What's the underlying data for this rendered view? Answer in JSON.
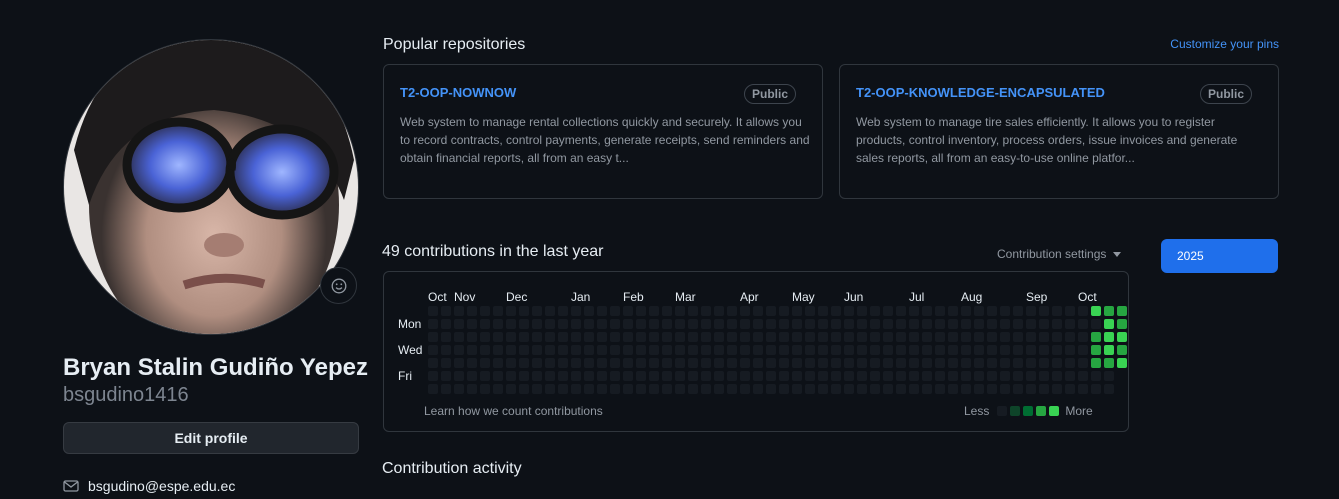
{
  "profile": {
    "full_name": "Bryan Stalin Gudiño Yepez",
    "username": "bsgudino1416",
    "edit_label": "Edit profile",
    "email": "bsgudino@espe.edu.ec",
    "status_icon": "smiley-icon"
  },
  "repos": {
    "title": "Popular repositories",
    "customize_label": "Customize your pins",
    "items": [
      {
        "name": "T2-OOP-NOWNOW",
        "visibility": "Public",
        "description": "Web system to manage rental collections quickly and securely. It allows you to record contracts, control payments, generate receipts, send reminders and obtain financial reports, all from an easy t..."
      },
      {
        "name": "T2-OOP-KNOWLEDGE-ENCAPSULATED",
        "visibility": "Public",
        "description": "Web system to manage tire sales efficiently. It allows you to register products, control inventory, process orders, issue invoices and generate sales reports, all from an easy-to-use online platfor..."
      }
    ]
  },
  "contributions": {
    "title": "49 contributions in the last year",
    "settings_label": "Contribution settings",
    "year_label": "2025",
    "learn_label": "Learn how we count contributions",
    "less_label": "Less",
    "more_label": "More",
    "months": [
      "Oct",
      "Nov",
      "Dec",
      "Jan",
      "Feb",
      "Mar",
      "Apr",
      "May",
      "Jun",
      "Jul",
      "Aug",
      "Sep",
      "Oct"
    ],
    "month_start_weeks": [
      0,
      2,
      6,
      11,
      15,
      19,
      24,
      28,
      32,
      37,
      41,
      46,
      50
    ],
    "day_labels": [
      "",
      "Mon",
      "",
      "Wed",
      "",
      "Fri",
      ""
    ],
    "weeks": 53,
    "level_colors": [
      "#161b22",
      "#0e4429",
      "#006d32",
      "#26a641",
      "#39d353"
    ],
    "active_cells": [
      {
        "week": 51,
        "day": 0,
        "level": 4
      },
      {
        "week": 51,
        "day": 2,
        "level": 3
      },
      {
        "week": 51,
        "day": 3,
        "level": 3
      },
      {
        "week": 51,
        "day": 4,
        "level": 3
      },
      {
        "week": 52,
        "day": 0,
        "level": 3
      },
      {
        "week": 52,
        "day": 1,
        "level": 4
      },
      {
        "week": 52,
        "day": 2,
        "level": 4
      },
      {
        "week": 52,
        "day": 3,
        "level": 4
      },
      {
        "week": 52,
        "day": 4,
        "level": 3
      },
      {
        "week": 53,
        "day": 0,
        "level": 3
      },
      {
        "week": 53,
        "day": 1,
        "level": 3
      },
      {
        "week": 53,
        "day": 2,
        "level": 4
      },
      {
        "week": 53,
        "day": 3,
        "level": 3
      },
      {
        "week": 53,
        "day": 4,
        "level": 4
      }
    ]
  },
  "activity": {
    "title": "Contribution activity"
  }
}
